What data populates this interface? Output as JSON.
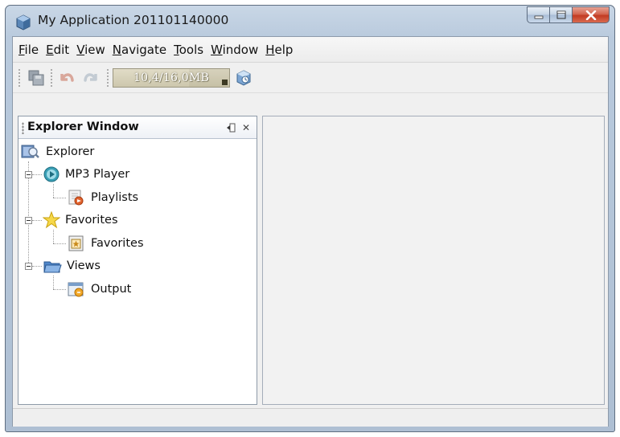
{
  "window": {
    "title": "My Application 201101140000"
  },
  "menubar": {
    "items": [
      {
        "first": "F",
        "rest": "ile"
      },
      {
        "first": "E",
        "rest": "dit"
      },
      {
        "first": "V",
        "rest": "iew"
      },
      {
        "first": "N",
        "rest": "avigate"
      },
      {
        "first": "T",
        "rest": "ools"
      },
      {
        "first": "W",
        "rest": "indow"
      },
      {
        "first": "H",
        "rest": "elp"
      }
    ]
  },
  "toolbar": {
    "memory_label": "10,4/16,0MB",
    "memory_used_fraction": 0.65,
    "icons": [
      "save-all-icon",
      "undo-icon",
      "redo-icon",
      "garbage-collect-icon"
    ]
  },
  "explorer": {
    "title": "Explorer Window",
    "root": "Explorer",
    "nodes": [
      {
        "label": "MP3 Player",
        "icon": "mp3-player-icon",
        "child": {
          "label": "Playlists",
          "icon": "playlists-icon"
        }
      },
      {
        "label": "Favorites",
        "icon": "favorites-star-icon",
        "child": {
          "label": "Favorites",
          "icon": "favorites-item-icon"
        }
      },
      {
        "label": "Views",
        "icon": "views-folder-icon",
        "child": {
          "label": "Output",
          "icon": "output-icon"
        }
      }
    ]
  },
  "colors": {
    "titlebar": "#b9cadd",
    "close_button": "#c23b22",
    "memory_bar": "#c6c0a5"
  }
}
